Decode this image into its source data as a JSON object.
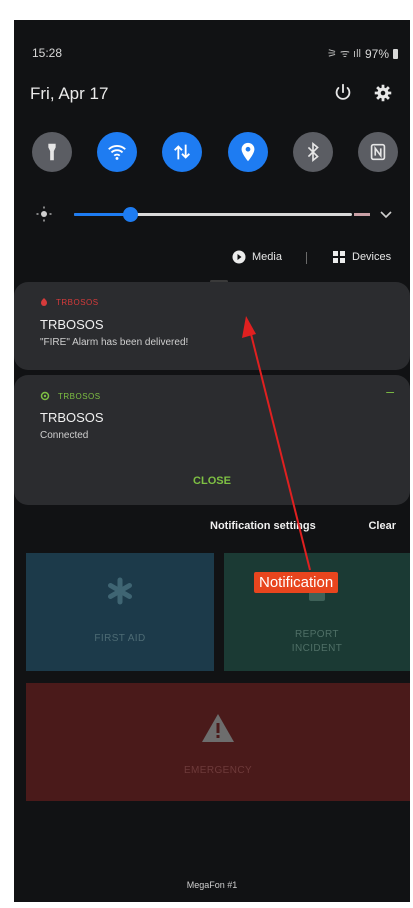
{
  "status_bar": {
    "time": "15:28",
    "icons": "⚞ ᯤ ıll",
    "battery": "97%"
  },
  "header": {
    "date": "Fri, Apr 17"
  },
  "media_row": {
    "media_label": "Media",
    "devices_label": "Devices"
  },
  "brightness": {
    "level": 0.2
  },
  "notifications": [
    {
      "app_name": "TRBOSOS",
      "title": "TRBOSOS",
      "body": "\"FIRE\" Alarm has been delivered!",
      "accent": "#d63b3b"
    },
    {
      "app_name": "TRBOSOS",
      "title": "TRBOSOS",
      "body": "Connected",
      "action": "CLOSE",
      "accent": "#7ec043"
    }
  ],
  "notification_actions": {
    "settings": "Notification settings",
    "clear": "Clear"
  },
  "tiles": {
    "first_aid": "FIRST AID",
    "report_line1": "REPORT",
    "report_line2": "INCIDENT",
    "emergency": "EMERGENCY"
  },
  "carrier": "MegaFon #1",
  "annotation": {
    "label": "Notification"
  },
  "colors": {
    "toggle_on": "#1e7cf2",
    "toggle_off": "#5b5d63",
    "annotation": "#e8451e"
  }
}
